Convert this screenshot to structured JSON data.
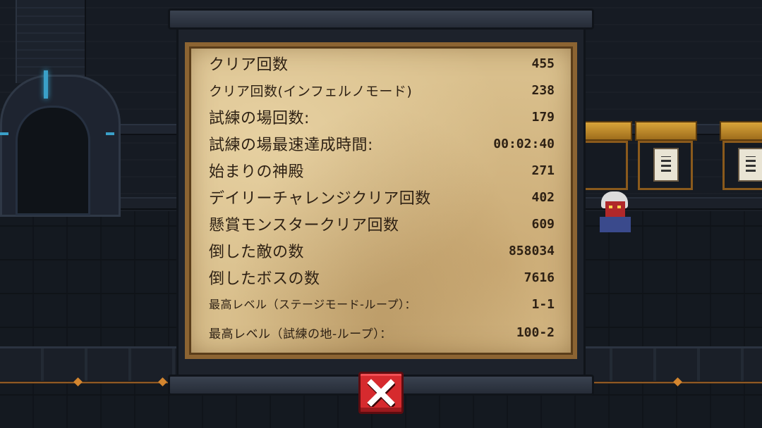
{
  "stats_panel": {
    "rows": [
      {
        "label": "クリア回数",
        "value": "455"
      },
      {
        "label": "クリア回数(インフェルノモード)",
        "value": "238"
      },
      {
        "label": "試練の場回数:",
        "value": "179"
      },
      {
        "label": "試練の場最速達成時間:",
        "value": "00:02:40"
      },
      {
        "label": "始まりの神殿",
        "value": "271"
      },
      {
        "label": "デイリーチャレンジクリア回数",
        "value": "402"
      },
      {
        "label": "懸賞モンスタークリア回数",
        "value": "609"
      },
      {
        "label": "倒した敵の数",
        "value": "858034"
      },
      {
        "label": "倒したボスの数",
        "value": "7616"
      },
      {
        "label": "最高レベル（ステージモード-ループ）：",
        "value": "1-1"
      },
      {
        "label": "最高レベル（試練の地-ループ）：",
        "value": "100-2"
      }
    ]
  },
  "close_button": {
    "icon": "close-icon",
    "color": "#d62a2e"
  },
  "colors": {
    "parchment": "#d9bf8c",
    "text": "#2e2114",
    "panel_frame": "#1d222b"
  }
}
